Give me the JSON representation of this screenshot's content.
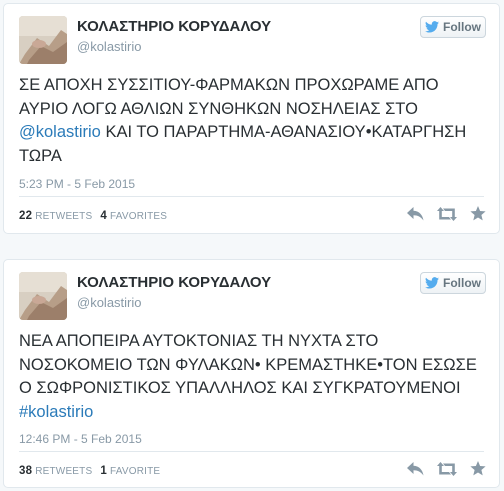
{
  "colors": {
    "link": "#2b7bb9",
    "muted": "#8899a6",
    "twitter_bird": "#55acee",
    "action_icon": "#8899a6"
  },
  "tweets": [
    {
      "display_name": "ΚΟΛΑΣΤΗΡΙΟ ΚΟΡΥΔΑΛΟΥ",
      "screen_name": "@kolastirio",
      "follow_label": "Follow",
      "text_before": "ΣΕ ΑΠΟΧΗ ΣΥΣΣΙΤΙΟΥ-ΦΑΡΜΑΚΩΝ ΠΡΟΧΩΡΑΜΕ ΑΠΟ ΑΥΡΙΟ ΛΟΓΩ ΑΘΛΙΩΝ ΣΥΝΘΗΚΩΝ ΝΟΣΗΛΕΙΑΣ ΣΤΟ ",
      "link": "@kolastirio",
      "text_after": " ΚΑΙ ΤΟ ΠΑΡΑΡΤΗΜΑ-ΑΘΑΝΑΣΙΟΥ•ΚΑΤΑΡΓΗΣΗ ΤΩΡΑ",
      "timestamp": "5:23 PM - 5 Feb 2015",
      "retweets_count": "22",
      "retweets_label": "RETWEETS",
      "favorites_count": "4",
      "favorites_label": "FAVORITES",
      "icons": [
        "reply-icon",
        "retweet-icon",
        "favorite-star-icon"
      ]
    },
    {
      "display_name": "ΚΟΛΑΣΤΗΡΙΟ ΚΟΡΥΔΑΛΟΥ",
      "screen_name": "@kolastirio",
      "follow_label": "Follow",
      "text_before": "ΝΕΑ ΑΠΟΠΕΙΡΑ ΑΥΤΟΚΤΟΝΙΑΣ ΤΗ ΝΥΧΤΑ ΣΤΟ ΝΟΣΟΚΟΜΕΙΟ ΤΩΝ ΦΥΛΑΚΩΝ• ΚΡΕΜΑΣΤΗΚΕ•ΤΟΝ ΕΣΩΣΕ Ο ΣΩΦΡΟΝΙΣΤΙΚΟΣ ΥΠΑΛΛΗΛΟΣ ΚΑΙ ΣΥΓΚΡΑΤΟΥΜΕΝΟΙ ",
      "link": "#kolastirio",
      "text_after": "",
      "timestamp": "12:46 PM - 5 Feb 2015",
      "retweets_count": "38",
      "retweets_label": "RETWEETS",
      "favorites_count": "1",
      "favorites_label": "FAVORITE",
      "icons": [
        "reply-icon",
        "retweet-icon",
        "favorite-star-icon"
      ]
    }
  ]
}
